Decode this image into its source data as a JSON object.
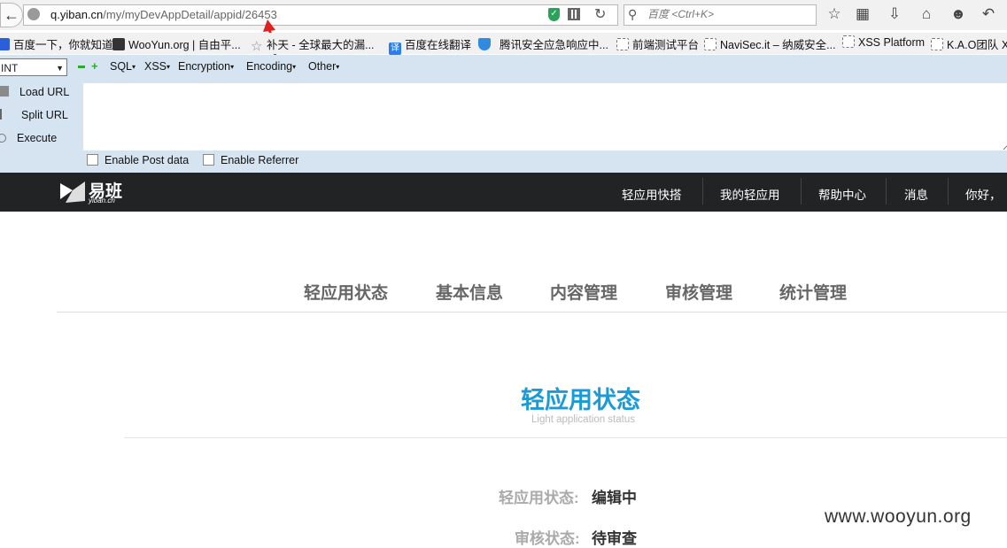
{
  "browser": {
    "url_host": "q.yiban.cn",
    "url_path": "/my/myDevAppDetail/appid/26453",
    "search_placeholder": "百度 <Ctrl+K>"
  },
  "bookmarks": [
    {
      "label": "百度一下，你就知道",
      "color": "#2b5fd9"
    },
    {
      "label": "WooYun.org | 自由平...",
      "color": "#333333"
    },
    {
      "label": "补天 - 全球最大的漏...",
      "color": "#888888"
    },
    {
      "label": "百度在线翻译",
      "color": "#2b7de9"
    },
    {
      "label": "腾讯安全应急响应中...",
      "color": "#2f8ae0"
    },
    {
      "label": "前端测试平台",
      "color": ""
    },
    {
      "label": "NaviSec.it – 纳威安全...",
      "color": ""
    },
    {
      "label": "XSS Platform",
      "color": ""
    },
    {
      "label": "K.A.O团队 X",
      "color": ""
    }
  ],
  "hackbar": {
    "select_value": "INT",
    "menus": [
      "SQL",
      "XSS",
      "Encryption",
      "Encoding",
      "Other"
    ],
    "load_url": "Load URL",
    "split_url": "Split URL",
    "execute": "Execute",
    "enable_post": "Enable Post data",
    "enable_referrer": "Enable Referrer"
  },
  "site": {
    "logo_text": "易班",
    "logo_sub": "yiban.cn",
    "nav": [
      "轻应用快搭",
      "我的轻应用",
      "帮助中心",
      "消息",
      "你好，"
    ],
    "tabs": [
      "轻应用状态",
      "基本信息",
      "内容管理",
      "审核管理",
      "统计管理"
    ],
    "section_title": "轻应用状态",
    "section_subtitle": "Light application status",
    "fields": [
      {
        "label": "轻应用状态:",
        "value": "编辑中"
      },
      {
        "label": "审核状态:",
        "value": "待审查"
      }
    ],
    "watermark": "www.wooyun.org"
  },
  "colors": {
    "accent": "#1a9ad6",
    "header_bg": "#222325",
    "hackbar_bg": "#d6e4f2"
  }
}
